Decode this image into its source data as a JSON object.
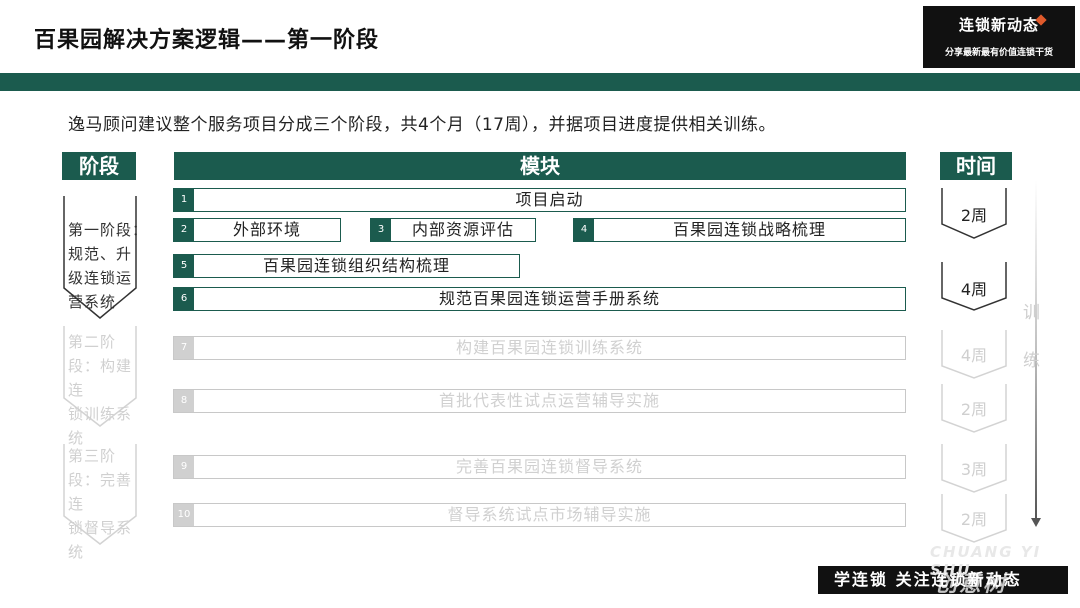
{
  "title": "百果园解决方案逻辑——第一阶段",
  "logo": {
    "main": "连锁新动态",
    "sub": "分享最新最有价值连锁干货"
  },
  "intro": "逸马顾问建议整个服务项目分成三个阶段，共4个月（17周），并据项目进度提供相关训练。",
  "headers": {
    "stage": "阶段",
    "module": "模块",
    "time": "时间"
  },
  "stages": [
    {
      "lines": [
        "第一阶段：",
        "规范、升",
        "级连锁运",
        "营系统"
      ],
      "active": true
    },
    {
      "lines": [
        "第二阶段：构建连",
        "锁训练系",
        "统"
      ],
      "active": false
    },
    {
      "lines": [
        "第三阶段：完善连",
        "锁督导系",
        "统"
      ],
      "active": false
    }
  ],
  "modules": [
    {
      "num": "1",
      "label": "项目启动",
      "active": true
    },
    {
      "num": "2",
      "label": "外部环境",
      "active": true
    },
    {
      "num": "3",
      "label": "内部资源评估",
      "active": true
    },
    {
      "num": "4",
      "label": "百果园连锁战略梳理",
      "active": true
    },
    {
      "num": "5",
      "label": "百果园连锁组织结构梳理",
      "active": true
    },
    {
      "num": "6",
      "label": "规范百果园连锁运营手册系统",
      "active": true
    },
    {
      "num": "7",
      "label": "构建百果园连锁训练系统",
      "active": false
    },
    {
      "num": "8",
      "label": "首批代表性试点运营辅导实施",
      "active": false
    },
    {
      "num": "9",
      "label": "完善百果园连锁督导系统",
      "active": false
    },
    {
      "num": "10",
      "label": "督导系统试点市场辅导实施",
      "active": false
    }
  ],
  "times": [
    {
      "label": "2周",
      "active": true
    },
    {
      "label": "4周",
      "active": true
    },
    {
      "label": "4周",
      "active": false
    },
    {
      "label": "2周",
      "active": false
    },
    {
      "label": "3周",
      "active": false
    },
    {
      "label": "2周",
      "active": false
    }
  ],
  "training": [
    "训",
    "练"
  ],
  "footer": {
    "text": "学连锁 关注连锁新动态",
    "wm_en": "CHUANG YI SHU",
    "wm_cn": "创意树"
  },
  "colors": {
    "accent": "#1b5b4e",
    "faded": "#d0d0d0"
  }
}
